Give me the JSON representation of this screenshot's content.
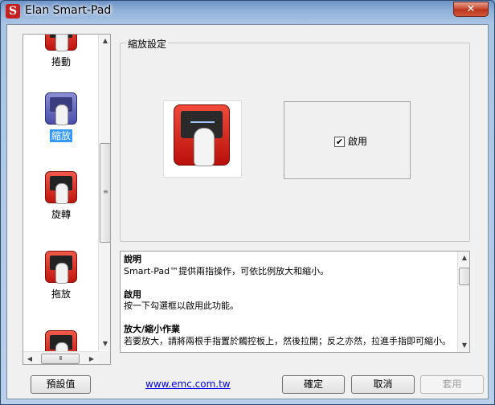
{
  "window": {
    "title": "Elan Smart-Pad",
    "close_glyph": "✕"
  },
  "sidebar": {
    "items": [
      {
        "label": "捲動",
        "icon": "scroll-icon"
      },
      {
        "label": "縮放",
        "icon": "zoom-icon",
        "selected": true
      },
      {
        "label": "旋轉",
        "icon": "rotate-icon"
      },
      {
        "label": "拖放",
        "icon": "drag-icon"
      }
    ]
  },
  "settings": {
    "group_title": "縮放設定",
    "enable_label": "啟用",
    "enable_checked": true,
    "check_glyph": "✔"
  },
  "description": {
    "sections": [
      {
        "heading": "說明",
        "body": "Smart-Pad™提供兩指操作，可依比例放大和縮小。"
      },
      {
        "heading": "啟用",
        "body": "按一下勾選框以啟用此功能。"
      },
      {
        "heading": "放大/縮小作業",
        "body": "若要放大，請將兩根手指置於觸控板上，然後拉開；反之亦然，拉進手指即可縮小。"
      }
    ]
  },
  "footer": {
    "defaults_label": "預設值",
    "link_text": "www.emc.com.tw",
    "ok_label": "確定",
    "cancel_label": "取消",
    "apply_label": "套用"
  },
  "colors": {
    "selection": "#3399ff",
    "icon_red": "#d0231a",
    "icon_blue": "#5a5fb8",
    "link": "#0000ee"
  }
}
